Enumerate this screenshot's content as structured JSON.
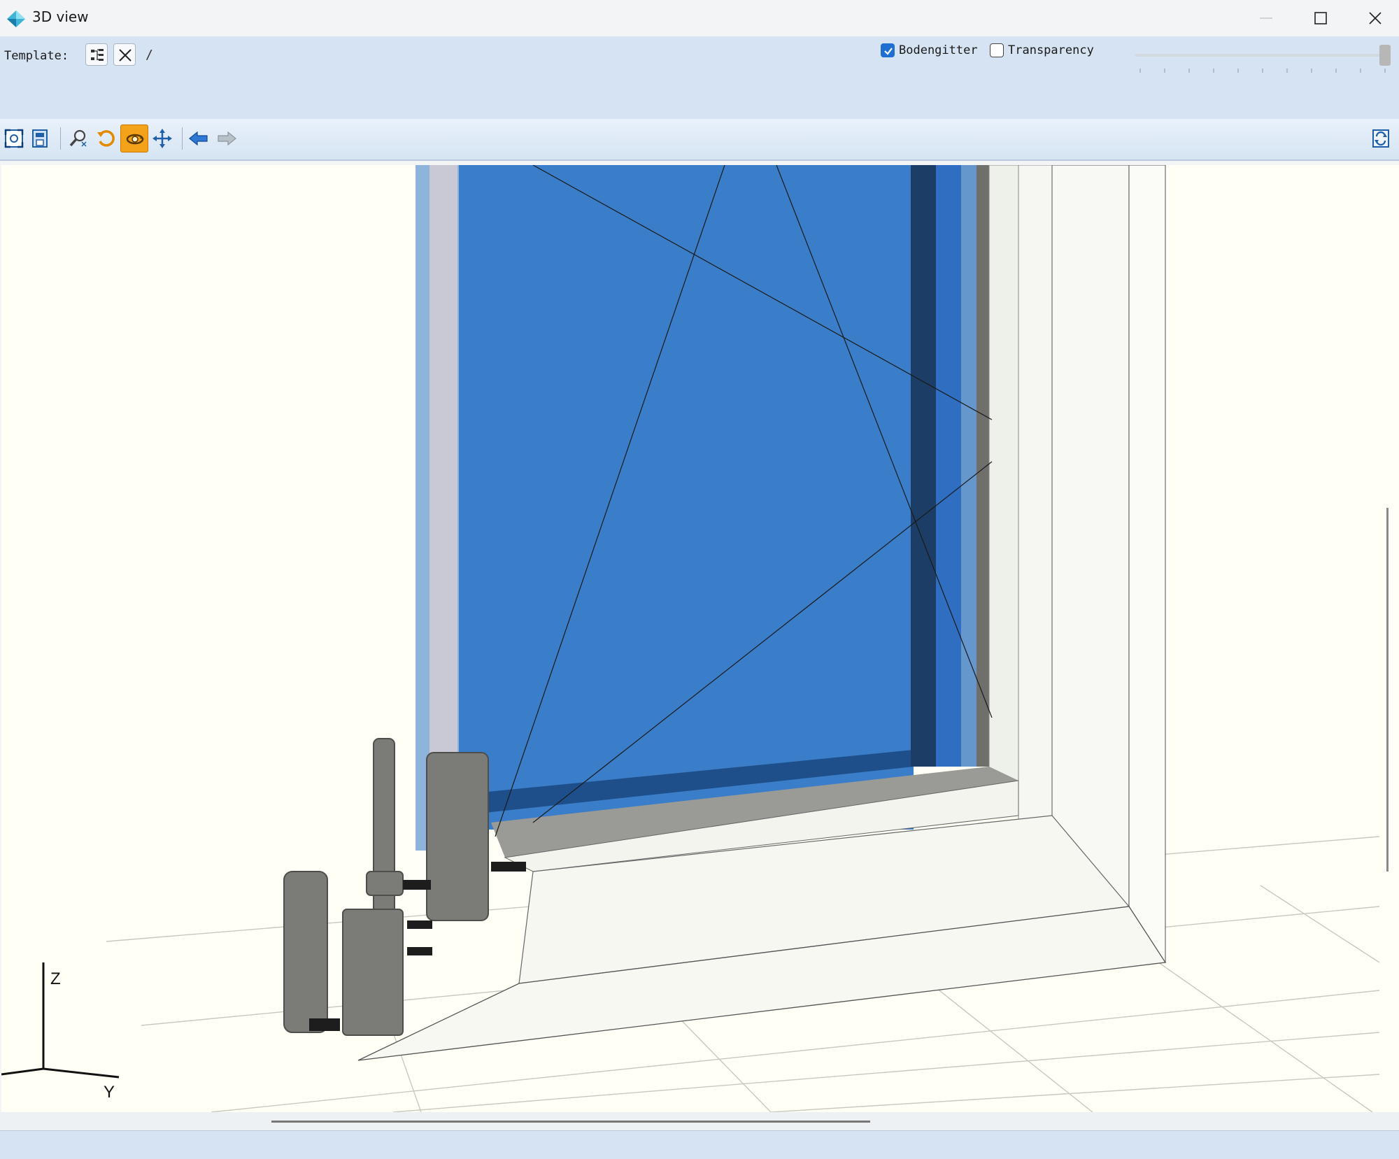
{
  "window": {
    "title": "3D view",
    "app_icon": "diamond-app-icon",
    "controls": [
      "minimize",
      "maximize",
      "close"
    ]
  },
  "options": {
    "template_label": "Template:",
    "template_value": "/",
    "bodengitter": {
      "label": "Bodengitter",
      "checked": true
    },
    "transparency": {
      "label": "Transparency",
      "checked": false,
      "level": 1.0
    }
  },
  "toolbar": {
    "buttons": [
      {
        "icon": "zoom-extents-icon"
      },
      {
        "icon": "save-view-icon"
      },
      {
        "icon": "zoom-icon"
      },
      {
        "icon": "rotate-icon"
      },
      {
        "icon": "orbit-icon",
        "active": true
      },
      {
        "icon": "pan-icon"
      },
      {
        "icon": "back-arrow-icon"
      },
      {
        "icon": "forward-arrow-icon"
      },
      {
        "icon": "refresh-view-icon"
      }
    ]
  },
  "viewport": {
    "axes": {
      "z": "Z",
      "y": "Y"
    },
    "colors": {
      "glass": "#3a7dc8",
      "frame": "#f4f5ef",
      "gasket": "#7a7a78",
      "background": "#fffff6"
    }
  }
}
